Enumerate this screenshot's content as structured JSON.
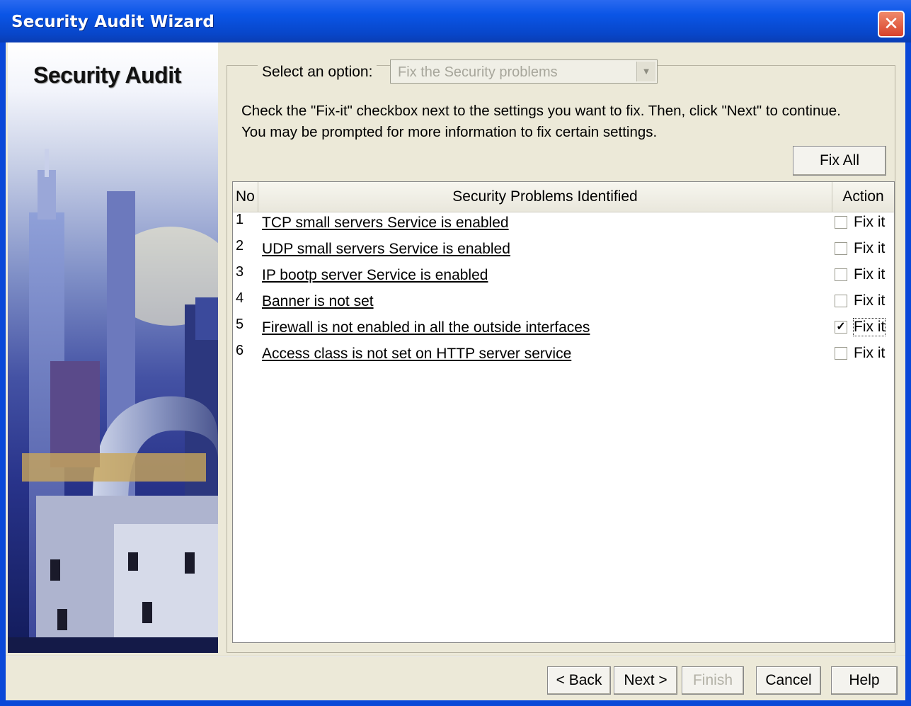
{
  "window": {
    "title": "Security Audit Wizard",
    "close_glyph": "✕"
  },
  "sidebar": {
    "title": "Security Audit"
  },
  "option": {
    "label": "Select an option:",
    "value": "Fix the Security problems",
    "arrow_glyph": "▼"
  },
  "instructions": {
    "line1": "Check the \"Fix-it\" checkbox next to the settings you want to fix. Then, click \"Next\" to continue.",
    "line2": "You may be prompted for more information to fix certain settings."
  },
  "fix_all_label": "Fix All",
  "table": {
    "headers": {
      "no": "No",
      "problems": "Security Problems Identified",
      "action": "Action"
    },
    "rows": [
      {
        "no": "1",
        "desc": "TCP small servers Service is enabled",
        "action": "Fix it",
        "checked": false
      },
      {
        "no": "2",
        "desc": "UDP small servers Service is enabled",
        "action": "Fix it",
        "checked": false
      },
      {
        "no": "3",
        "desc": "IP bootp server Service is enabled",
        "action": "Fix it",
        "checked": false
      },
      {
        "no": "4",
        "desc": "Banner is not set",
        "action": "Fix it",
        "checked": false
      },
      {
        "no": "5",
        "desc": "Firewall is not enabled in all the outside interfaces",
        "action": "Fix it",
        "checked": true
      },
      {
        "no": "6",
        "desc": "Access class is not set on HTTP server service",
        "action": "Fix it",
        "checked": false
      }
    ]
  },
  "buttons": {
    "back": "< Back",
    "next": "Next >",
    "finish": "Finish",
    "cancel": "Cancel",
    "help": "Help"
  },
  "check_glyph": "✓"
}
